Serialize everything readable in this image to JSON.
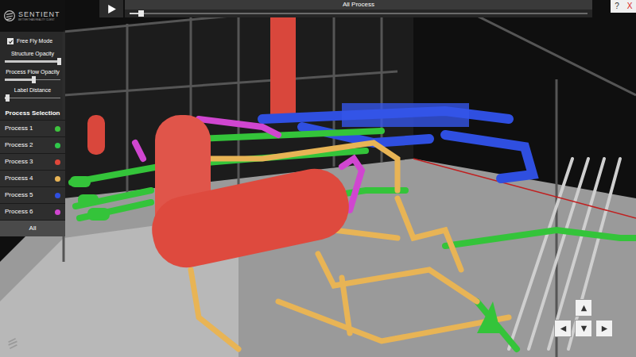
{
  "top_bar": {
    "title": "All Process",
    "timeline": {
      "level": 0.02
    }
  },
  "window_buttons": {
    "help": "?",
    "close": "X"
  },
  "logo": {
    "name": "SENTIENT",
    "tagline": "BETTER THAN REALITY CLIENT"
  },
  "controls": {
    "free_fly": {
      "label": "Free Fly Mode",
      "checked": true
    },
    "sliders": [
      {
        "label": "Structure Opacity",
        "level": 0.97
      },
      {
        "label": "Process Flow Opacity",
        "level": 0.52
      },
      {
        "label": "Label Distance",
        "level": 0.04
      }
    ]
  },
  "process_selection": {
    "title": "Process Selection",
    "items": [
      {
        "label": "Process 1",
        "color": "#3ec43e",
        "selected": false
      },
      {
        "label": "Process 2",
        "color": "#2fc84a",
        "selected": false
      },
      {
        "label": "Process 3",
        "color": "#e0473a",
        "selected": false
      },
      {
        "label": "Process 4",
        "color": "#e8b455",
        "selected": false
      },
      {
        "label": "Process 5",
        "color": "#2f4fe0",
        "selected": false
      },
      {
        "label": "Process 6",
        "color": "#d046d0",
        "selected": false
      }
    ],
    "all_button": {
      "label": "All",
      "selected": true
    }
  }
}
